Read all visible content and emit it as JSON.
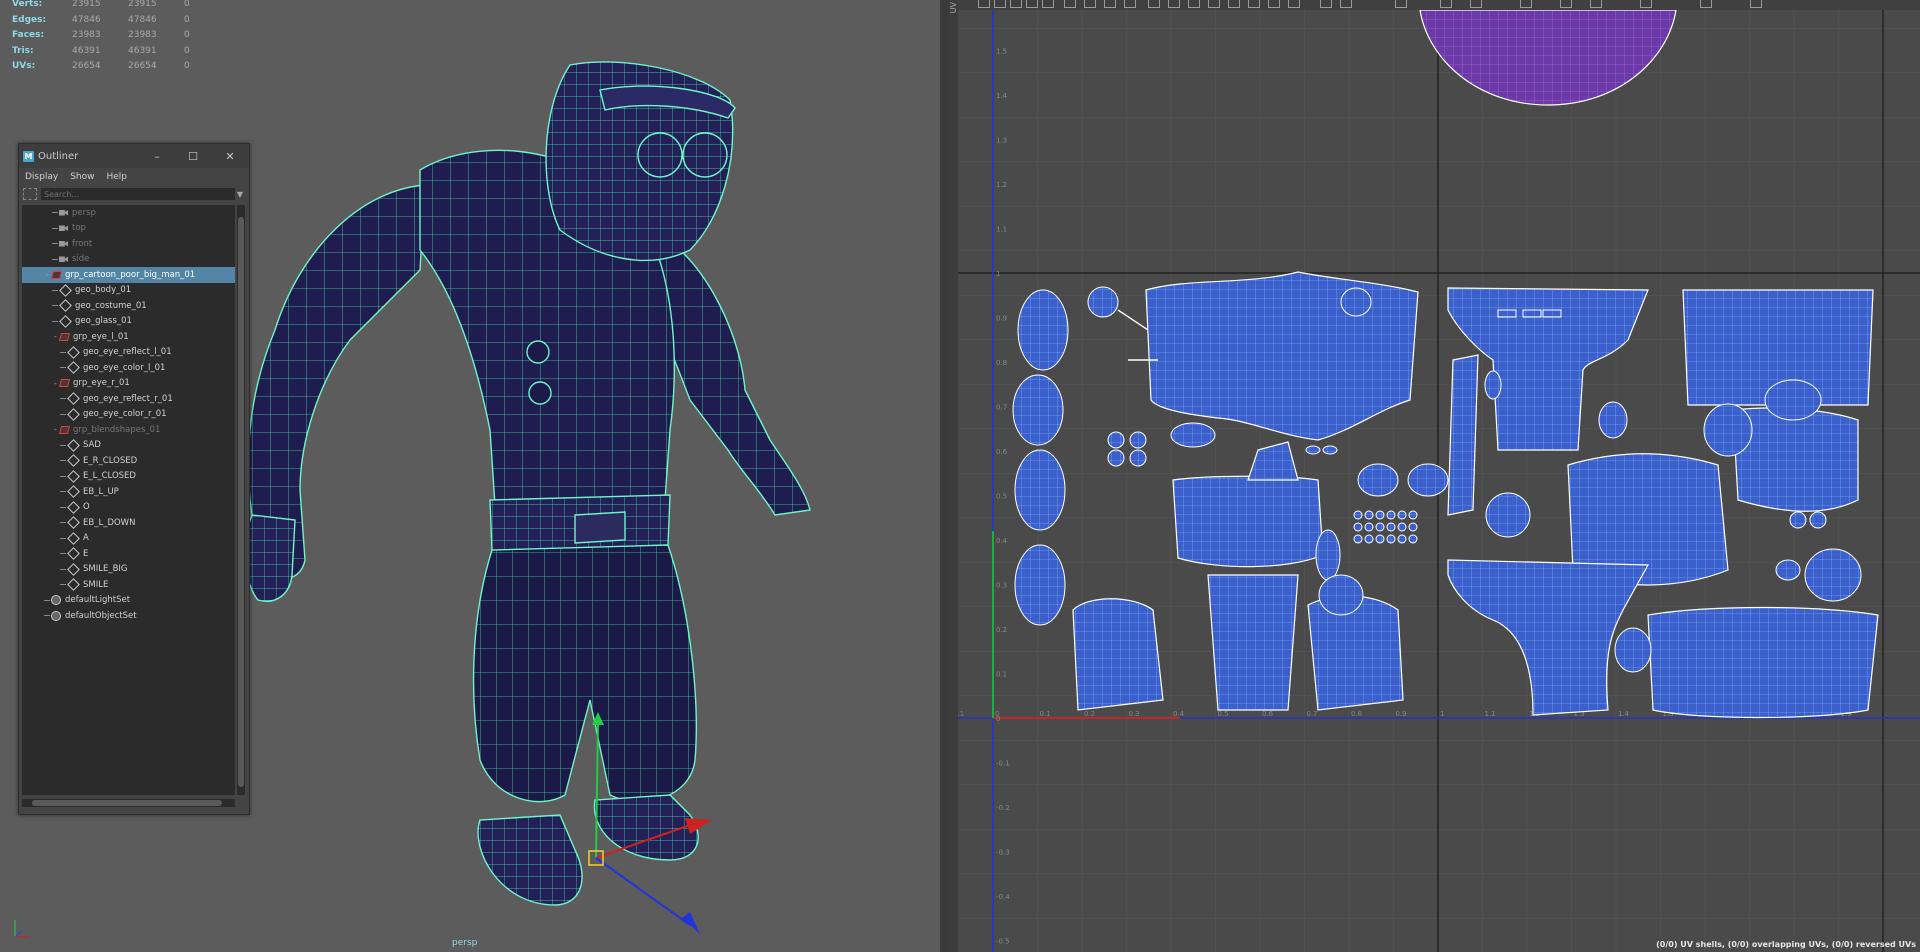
{
  "hud": {
    "rows": [
      {
        "label": "Verts:",
        "a": "23915",
        "b": "23915",
        "c": "0"
      },
      {
        "label": "Edges:",
        "a": "47846",
        "b": "47846",
        "c": "0"
      },
      {
        "label": "Faces:",
        "a": "23983",
        "b": "23983",
        "c": "0"
      },
      {
        "label": "Tris:",
        "a": "46391",
        "b": "46391",
        "c": "0"
      },
      {
        "label": "UVs:",
        "a": "26654",
        "b": "26654",
        "c": "0"
      }
    ]
  },
  "viewport": {
    "camera_label": "persp"
  },
  "outliner": {
    "title": "Outliner",
    "menu": [
      "Display",
      "Show",
      "Help"
    ],
    "search_placeholder": "Search...",
    "items": [
      {
        "label": "persp",
        "icon": "camera-icon",
        "indent": 1,
        "dim": true
      },
      {
        "label": "top",
        "icon": "camera-icon",
        "indent": 1,
        "dim": true
      },
      {
        "label": "front",
        "icon": "camera-icon",
        "indent": 1,
        "dim": true
      },
      {
        "label": "side",
        "icon": "camera-icon",
        "indent": 1,
        "dim": true
      },
      {
        "label": "grp_cartoon_poor_big_man_01",
        "icon": "group-icon",
        "indent": 0,
        "expand": "-",
        "selected": true
      },
      {
        "label": "geo_body_01",
        "icon": "mesh-icon",
        "indent": 1
      },
      {
        "label": "geo_costume_01",
        "icon": "mesh-icon",
        "indent": 1
      },
      {
        "label": "geo_glass_01",
        "icon": "mesh-icon",
        "indent": 1
      },
      {
        "label": "grp_eye_l_01",
        "icon": "group-icon",
        "indent": 1,
        "expand": "-"
      },
      {
        "label": "geo_eye_reflect_l_01",
        "icon": "mesh-icon",
        "indent": 2
      },
      {
        "label": "geo_eye_color_l_01",
        "icon": "mesh-icon",
        "indent": 2
      },
      {
        "label": "grp_eye_r_01",
        "icon": "group-icon",
        "indent": 1,
        "expand": "-"
      },
      {
        "label": "geo_eye_reflect_r_01",
        "icon": "mesh-icon",
        "indent": 2
      },
      {
        "label": "geo_eye_color_r_01",
        "icon": "mesh-icon",
        "indent": 2
      },
      {
        "label": "grp_blendshapes_01",
        "icon": "group-icon",
        "indent": 1,
        "expand": "-",
        "dim": true
      },
      {
        "label": "SAD",
        "icon": "mesh-icon",
        "indent": 2
      },
      {
        "label": "E_R_CLOSED",
        "icon": "mesh-icon",
        "indent": 2
      },
      {
        "label": "E_L_CLOSED",
        "icon": "mesh-icon",
        "indent": 2
      },
      {
        "label": "EB_L_UP",
        "icon": "mesh-icon",
        "indent": 2
      },
      {
        "label": "O",
        "icon": "mesh-icon",
        "indent": 2
      },
      {
        "label": "EB_L_DOWN",
        "icon": "mesh-icon",
        "indent": 2
      },
      {
        "label": "A",
        "icon": "mesh-icon",
        "indent": 2
      },
      {
        "label": "E",
        "icon": "mesh-icon",
        "indent": 2
      },
      {
        "label": "SMILE_BIG",
        "icon": "mesh-icon",
        "indent": 2
      },
      {
        "label": "SMILE",
        "icon": "mesh-icon",
        "indent": 2
      },
      {
        "label": "defaultLightSet",
        "icon": "set-icon",
        "indent": 0
      },
      {
        "label": "defaultObjectSet",
        "icon": "set-icon",
        "indent": 0
      }
    ]
  },
  "uv_editor": {
    "side_label": "UV",
    "status": "(0/0) UV shells, (0/0) overlapping UVs, (0/0) reversed UVs",
    "v_ticks": [
      "1.5",
      "1.4",
      "1.3",
      "1.2",
      "1.1",
      "1",
      "0.9",
      "0.8",
      "0.7",
      "0.6",
      "0.5",
      "0.4",
      "0.3",
      "0.2",
      "0.1",
      "0",
      "-0.1",
      "-0.2",
      "-0.3",
      "-0.4",
      "-0.5"
    ],
    "u_ticks": [
      "-0.1",
      "0",
      "0.1",
      "0.2",
      "0.3",
      "0.4",
      "0.5",
      "0.6",
      "0.7",
      "0.8",
      "0.9",
      "1",
      "1.1",
      "1.2",
      "1.3",
      "1.4",
      "1.5",
      "1.6",
      "1.7",
      "1.8",
      "1.9"
    ]
  },
  "colors": {
    "wire": "#5cf0c0",
    "uv_fill": "#3a5ec8",
    "uv_grid": "#6fd6ff",
    "viewport_bg": "#5c5c5c",
    "selection": "#5285a6"
  }
}
